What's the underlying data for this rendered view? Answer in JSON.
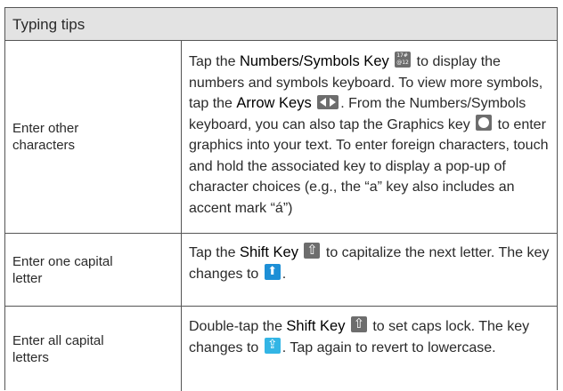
{
  "table": {
    "title": "Typing tips",
    "rows": [
      {
        "label": "Enter other characters",
        "desc": [
          "Tap the ",
          {
            "key": "Numbers/Symbols Key"
          },
          " ",
          {
            "icon": "numbers-symbols-key-icon"
          },
          " to display the numbers and symbols keyboard. To view more symbols, tap the ",
          {
            "key": "Arrow Keys"
          },
          " ",
          {
            "icon": "arrow-keys-icon"
          },
          ". From the Numbers/Symbols keyboard, you can also tap the Graphics key ",
          {
            "icon": "graphics-key-icon"
          },
          " to enter graphics into your text. To enter foreign characters, touch and hold the associated key to display a pop-up of character choices (e.g., the “a” key also includes an accent mark “á”)"
        ]
      },
      {
        "label": "Enter one capital letter",
        "desc": [
          "Tap the ",
          {
            "key": "Shift Key"
          },
          " ",
          {
            "icon": "shift-key-icon"
          },
          " to capitalize the next letter. The key changes to ",
          {
            "icon": "shift-active-icon"
          },
          "."
        ]
      },
      {
        "label": "Enter all capital letters",
        "desc": [
          "Double-tap the ",
          {
            "key": "Shift Key"
          },
          " ",
          {
            "icon": "shift-key-icon"
          },
          " to set caps lock. The key changes to ",
          {
            "icon": "caps-lock-icon"
          },
          ". Tap again to revert to lowercase."
        ]
      }
    ]
  }
}
